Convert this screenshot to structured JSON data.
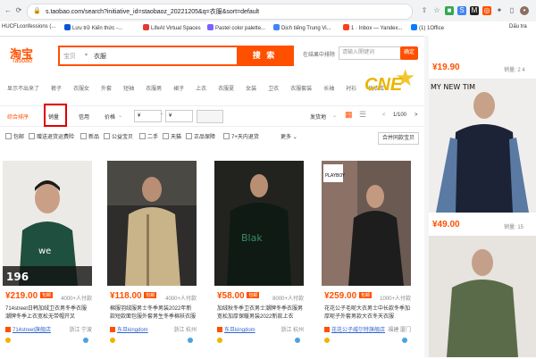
{
  "browser": {
    "url": "s.taobao.com/search?initiative_id=staobaoz_20221205&q=衣服&sort=default",
    "bookmarks": [
      {
        "label": "HUCFLconfessions (..."
      },
      {
        "label": "Lưu trữ Kiến thức -..."
      },
      {
        "label": "LifeAt Virtual Spaces"
      },
      {
        "label": "Pastel color palette..."
      },
      {
        "label": "Dịch tiếng Trung Vi..."
      },
      {
        "label": "1 · Inbox — Yandex..."
      },
      {
        "label": "(1) 1Office"
      },
      {
        "label": "Dấu tra"
      }
    ]
  },
  "header": {
    "logo": "淘宝",
    "logo_sub": "Taobao",
    "search_scope": "宝贝",
    "query": "衣服",
    "search_button": "搜 索",
    "sub_search_label": "在结果中排除",
    "sub_search_placeholder": "请输入関键词",
    "sub_search_ok": "确定",
    "badge_text": "CNE"
  },
  "hot_words": [
    "显示不出来了",
    "裤子",
    "衣服女",
    "外套",
    "短袖",
    "衣服男",
    "裙子",
    "上衣",
    "衣服夏",
    "女装",
    "卫衣",
    "衣服套装",
    "长袖",
    "衬衫",
    "优衣库"
  ],
  "sort_bar": {
    "items": [
      "综合排序",
      "销量",
      "信用",
      "价格"
    ],
    "price_from": "¥",
    "price_to": "¥",
    "ship_from": "发货地",
    "page": "1/100",
    "prev": "<",
    "next": ">"
  },
  "filters": [
    "包邮",
    "赠送退货运费险",
    "新品",
    "公益宝贝",
    "二手",
    "天猫",
    "正品保障",
    "7+天内退货",
    "更多"
  ],
  "cart_button": "合并同款宝贝",
  "products": [
    {
      "price": "¥219.00",
      "badge": "包邮",
      "paid": "4000+人付款",
      "title": "714street日韩加绒卫衣男冬季衣服潮牌冬季上衣宽松无带帽开叉",
      "store": "714street旗舰店",
      "location": "浙江 宁波",
      "img_caption": "196",
      "bg": "#e9e6e1",
      "fg": "#1f4f3f"
    },
    {
      "price": "¥118.00",
      "badge": "包邮",
      "paid": "4000+人付款",
      "title": "棉服羽绒服男士冬季男装2022年新款短款面包服外套男生冬季棉袄衣服",
      "store": "东旦kingdom",
      "location": "浙江 杭州",
      "img_caption": "",
      "bg": "#3a3936",
      "fg": "#c9b48a"
    },
    {
      "price": "¥58.00",
      "badge": "包邮",
      "paid": "8000+人付款",
      "title": "加绒秋冬季卫衣男士潮牌冬季衣服男宽松加厚保暖男装2022新款上衣",
      "store": "东旦kingdom",
      "location": "浙江 杭州",
      "img_caption": "",
      "bg": "#1e1f1c",
      "fg": "#143024"
    },
    {
      "price": "¥259.00",
      "badge": "包邮",
      "paid": "1000+人付款",
      "title": "花花公子毛呢大衣男士中长款冬季加厚呢子外套男款大衣冬天衣服",
      "store": "花花公子威尔特旗舰店",
      "location": "福建 厦门",
      "img_caption": "PLAYBOY",
      "bg": "#6b5a52",
      "fg": "#1d1d1d"
    }
  ],
  "right_column": {
    "top_price": "¥19.90",
    "top_paid": "销量: 2 4",
    "mid_price": "¥49.00",
    "mid_paid": "销量: 15",
    "mid_caption": "MY NEW TIM"
  }
}
